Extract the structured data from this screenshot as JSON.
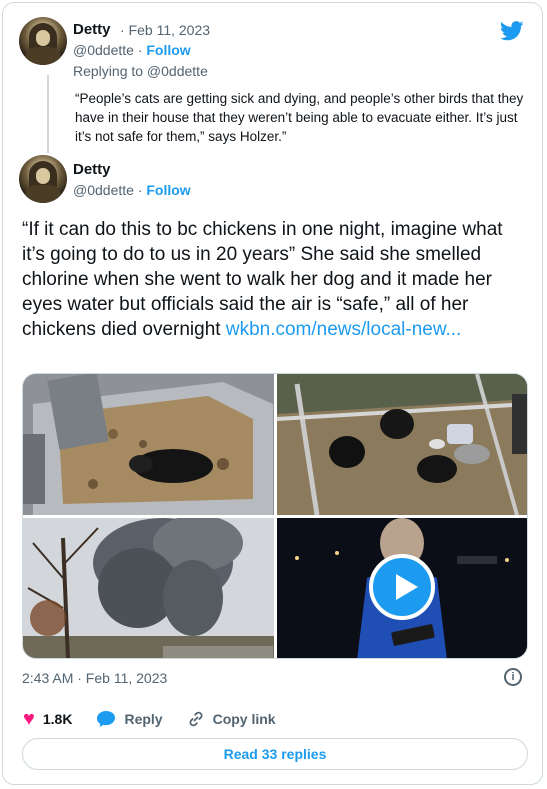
{
  "colors": {
    "accent": "#1d9bf0",
    "like": "#f91880",
    "muted": "#536471",
    "text": "#0f1419",
    "border": "#cfd9de"
  },
  "parent_tweet": {
    "author": "Detty",
    "date": "· Feb 11, 2023",
    "handle": "@0ddette",
    "follow": "Follow",
    "replying_to": "Replying to @0ddette",
    "text": "“People’s cats are getting sick and dying, and people’s other birds that they have in their house that they weren’t being able to evacuate either. It’s just it’s not safe for them,” says Holzer.”"
  },
  "main_tweet": {
    "author": "Detty",
    "handle": "@0ddette",
    "follow": "Follow",
    "text": "“If it can do this to bc chickens in one night, imagine what it’s going to do to us in 20 years” She said she smelled chlorine when she went to walk her dog and it made her eyes water but officials said the air is “safe,” all of her chickens died overnight ",
    "link_text": "wkbn.com/news/local-new...",
    "timestamp": "2:43 AM · Feb 11, 2023"
  },
  "actions": {
    "likes": "1.8K",
    "reply": "Reply",
    "copy_link": "Copy link"
  },
  "read_replies": "Read 33 replies",
  "icons": [
    "twitter-bird-icon",
    "play-icon",
    "info-icon",
    "heart-icon",
    "reply-bubble-icon",
    "link-icon"
  ]
}
